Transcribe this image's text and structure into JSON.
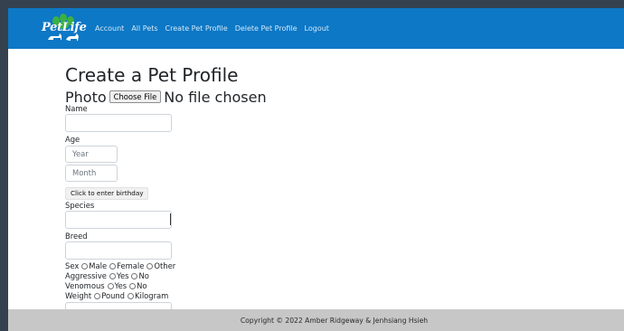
{
  "navbar": {
    "brand": "PetLife",
    "links": [
      "Account",
      "All Pets",
      "Create Pet Profile",
      "Delete Pet Profile",
      "Logout"
    ]
  },
  "form": {
    "title": "Create a Pet Profile",
    "photo_label": "Photo",
    "file_button": "Choose File",
    "file_status": "No file chosen",
    "name_label": "Name",
    "name_value": "",
    "age_label": "Age",
    "year_placeholder": "Year",
    "month_placeholder": "Month",
    "birthday_button": "Click to enter birthday",
    "species_label": "Species",
    "species_value": "",
    "breed_label": "Breed",
    "breed_value": "",
    "sex": {
      "label": "Sex",
      "options": [
        "Male",
        "Female",
        "Other"
      ]
    },
    "aggressive": {
      "label": "Aggressive",
      "options": [
        "Yes",
        "No"
      ]
    },
    "venomous": {
      "label": "Venomous",
      "options": [
        "Yes",
        "No"
      ]
    },
    "weight": {
      "label": "Weight",
      "options": [
        "Pound",
        "Kilogram"
      ],
      "value": ""
    }
  },
  "footer": {
    "text": "Copyright © 2022 Amber Ridgeway & Jenhsiang Hsieh"
  },
  "colors": {
    "navbar": "#0d78c6",
    "footer": "#c7c7c7",
    "frame": "#35414f"
  }
}
